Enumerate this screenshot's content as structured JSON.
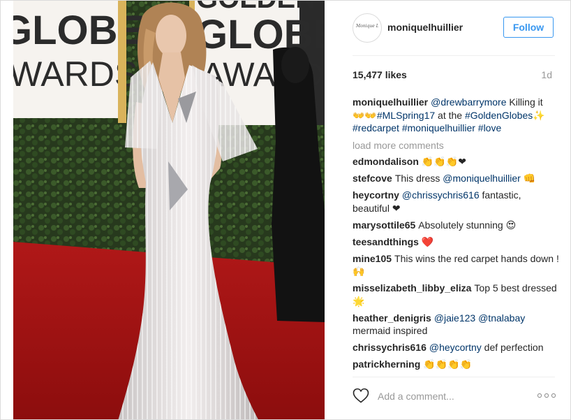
{
  "post": {
    "username": "moniquelhuillier",
    "avatar_text": "Monique Lhuillier",
    "follow_label": "Follow",
    "likes": "15,477 likes",
    "age": "1d",
    "photo_signage": [
      "GLOBE",
      "WARDS",
      "GOLDEN",
      "GLOBE",
      "AWARDS"
    ]
  },
  "caption": {
    "user": "moniquelhuillier",
    "mention": "@drewbarrymore",
    "text1": " Killing it ",
    "emoji1": "👐👐",
    "tag1": "#MLSpring17",
    "text2": " at the ",
    "tag2": "#GoldenGlobes",
    "emoji2": " ✨",
    "tag3": "#redcarpet",
    "tag4": "#moniquelhuillier",
    "tag5": "#love"
  },
  "load_more": "load more comments",
  "comments": [
    {
      "user": "edmondalison",
      "text": "👏👏👏❤"
    },
    {
      "user": "stefcove",
      "text": "This dress ",
      "mention": "@moniquelhuillier",
      "emoji": " 👊"
    },
    {
      "user": "heycortny",
      "mention": "@chrissychris616",
      "text": " fantastic, beautiful ❤"
    },
    {
      "user": "marysottile65",
      "text": "Absolutely stunning 😍"
    },
    {
      "user": "teesandthings",
      "text": "❤️"
    },
    {
      "user": "mine105",
      "text": "This wins the red carpet hands down ! 🙌"
    },
    {
      "user": "misselizabeth_libby_eliza",
      "text": "Top 5 best dressed 🌟"
    },
    {
      "user": "heather_denigris",
      "mention": "@jaie123",
      "mention2": "@tnalabay",
      "text": "mermaid inspired"
    },
    {
      "user": "chrissychris616",
      "mention": "@heycortny",
      "text": " def perfection"
    },
    {
      "user": "patrickherning",
      "text": "👏👏👏👏"
    }
  ],
  "comment_input": {
    "placeholder": "Add a comment..."
  },
  "icons": {
    "like": "heart-icon",
    "more": "more-options-icon"
  },
  "colors": {
    "accent": "#3897f0",
    "link": "#003569",
    "muted": "#999999",
    "border": "#dbdbdb"
  }
}
